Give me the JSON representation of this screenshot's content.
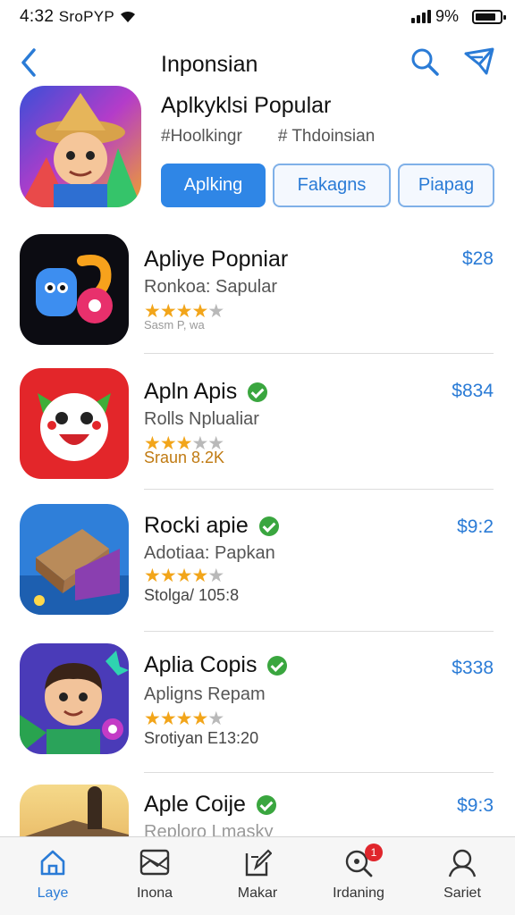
{
  "status_bar": {
    "time": "4:32",
    "carrier": "SroPYP",
    "battery": "9%"
  },
  "nav": {
    "title": "Inponsian"
  },
  "hero": {
    "title": "Aplkyklsi Popular",
    "tags": [
      "#Hoolkingr",
      "# Thdoinsian"
    ],
    "buttons": [
      "Aplking",
      "Fakagns",
      "Piapag"
    ]
  },
  "apps": [
    {
      "name": "Apliye Popniar",
      "subtitle": "Ronkoa: Sapular",
      "stars": "★★★★",
      "stars_off": "★",
      "meta": "Sasm P, wa",
      "price": "$28",
      "verified": false
    },
    {
      "name": "Apln Apis",
      "subtitle": "Rolls Nplualiar",
      "stars": "★★★",
      "stars_off": "★★",
      "meta": "Sraun 8.2K",
      "price": "$834",
      "verified": true
    },
    {
      "name": "Rocki apie",
      "subtitle": "Adotiaa: Papkan",
      "stars": "★★★★",
      "stars_off": "★",
      "meta": "Stolga/ 105:8",
      "price": "$9:2",
      "verified": true
    },
    {
      "name": "Aplia Copis",
      "subtitle": "Apligns Repam",
      "stars": "★★★★",
      "stars_off": "★",
      "meta": "Srotiyan E13:20",
      "price": "$338",
      "verified": true
    },
    {
      "name": "Aple Coije",
      "subtitle": "Reploro Lmasky",
      "stars": "",
      "stars_off": "",
      "meta": "",
      "price": "$9:3",
      "verified": true
    }
  ],
  "tabbar": {
    "tabs": [
      {
        "label": "Laye"
      },
      {
        "label": "Inona"
      },
      {
        "label": "Makar"
      },
      {
        "label": "Irdaning",
        "badge": "1"
      },
      {
        "label": "Sariet"
      }
    ]
  },
  "colors": {
    "accent": "#2f86e6",
    "star": "#f2a51a",
    "verified": "#3aa63f",
    "badge": "#e0262c"
  }
}
